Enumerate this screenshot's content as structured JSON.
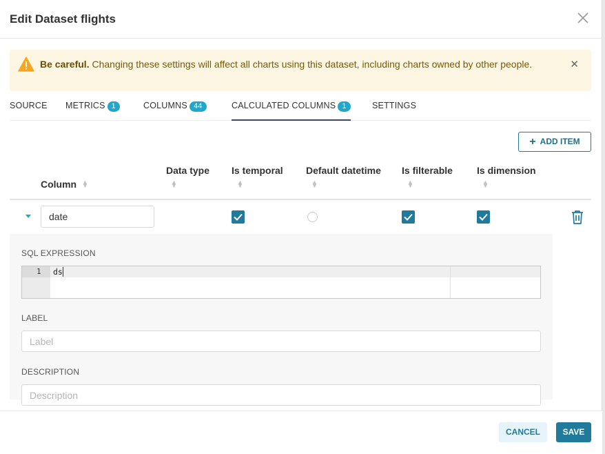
{
  "modal": {
    "title": "Edit Dataset flights"
  },
  "alert": {
    "bold": "Be careful.",
    "message": "Changing these settings will affect all charts using this dataset, including charts owned by other people."
  },
  "tabs": [
    {
      "label": "SOURCE",
      "badge": null,
      "active": false
    },
    {
      "label": "METRICS",
      "badge": "1",
      "active": false
    },
    {
      "label": "COLUMNS",
      "badge": "44",
      "active": false
    },
    {
      "label": "CALCULATED COLUMNS",
      "badge": "1",
      "active": true
    },
    {
      "label": "SETTINGS",
      "badge": null,
      "active": false
    }
  ],
  "add_item_label": "ADD ITEM",
  "table": {
    "headers": {
      "column": "Column",
      "data_type": "Data type",
      "is_temporal": "Is temporal",
      "default_datetime": "Default datetime",
      "is_filterable": "Is filterable",
      "is_dimension": "Is dimension"
    },
    "row": {
      "column_name": "date",
      "is_temporal": true,
      "default_datetime": false,
      "is_filterable": true,
      "is_dimension": true
    }
  },
  "detail": {
    "sql_label": "SQL EXPRESSION",
    "sql_line_number": "1",
    "sql_code": "ds",
    "label_label": "LABEL",
    "label_placeholder": "Label",
    "description_label": "DESCRIPTION",
    "description_placeholder": "Description"
  },
  "footer": {
    "cancel": "CANCEL",
    "save": "SAVE"
  },
  "colors": {
    "accent": "#1f7a9c",
    "badge": "#20a7c9",
    "warning_bg": "#fdf6e3",
    "warning_icon": "#f5a623"
  }
}
